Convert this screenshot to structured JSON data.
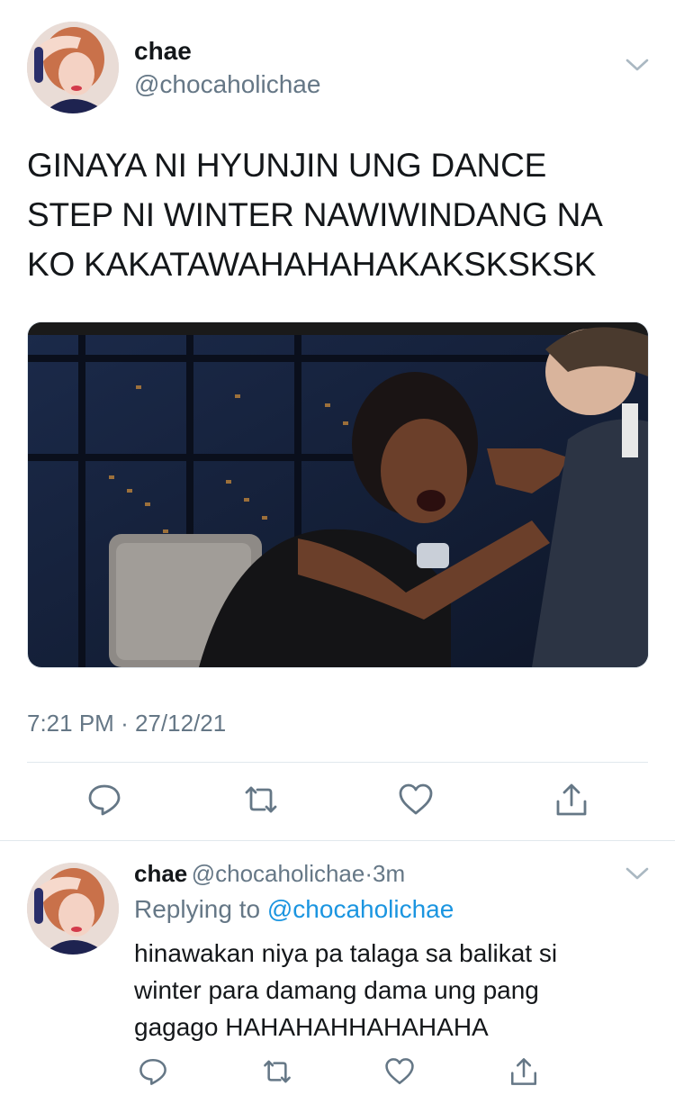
{
  "main_tweet": {
    "name": "chae",
    "handle": "@chocaholichae",
    "text_lines": [
      "GINAYA NI HYUNJIN UNG DANCE",
      "STEP NI WINTER NAWIWINDANG NA",
      "KO KAKATAWAHAHAHAKAKSKSKSK"
    ],
    "time": "7:21 PM",
    "separator": "·",
    "date": "27/12/21"
  },
  "reply_tweet": {
    "name": "chae",
    "handle": "@chocaholichae",
    "dot": "·",
    "age": "3m",
    "replying_label": "Replying to",
    "replying_to": "@chocaholichae",
    "text_lines": [
      "hinawakan niya pa talaga sa balikat si",
      "winter para damang dama ung pang",
      "gagago HAHAHAHHAHAHAHA"
    ]
  },
  "icons": {
    "reply": "reply-icon",
    "retweet": "retweet-icon",
    "like": "heart-icon",
    "share": "share-icon",
    "more": "chevron-down-icon"
  },
  "colors": {
    "link": "#1b95e0",
    "secondary_text": "#657786",
    "icon": "#657786",
    "divider": "#e1e8ed"
  }
}
